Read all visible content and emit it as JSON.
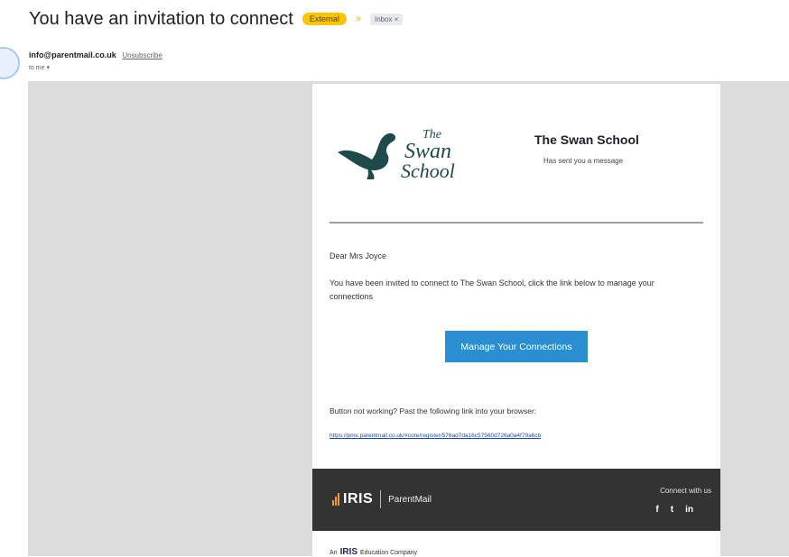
{
  "subject": "You have an invitation to connect",
  "labels": {
    "external": "External",
    "inbox": "Inbox ×"
  },
  "sender": {
    "email": "info@parentmail.co.uk",
    "unsubscribe": "Unsubscribe",
    "to": "to me"
  },
  "email": {
    "logo_text": [
      "The",
      "Swan",
      "School"
    ],
    "school_name": "The Swan School",
    "sent_message": "Has sent you a message",
    "greeting": "Dear Mrs Joyce",
    "body": "You have been invited to connect to The Swan School, click the link below to manage your connections",
    "cta_label": "Manage Your Connections",
    "fallback_text": "Button not working? Past the following link into your browser:",
    "link": "https://pmx.parentmail.co.uk/#core/register/576ad7da16c57560d726a0a4f79a6cb",
    "footer": {
      "brand": "IRIS",
      "product": "ParentMail",
      "connect": "Connect with us",
      "social": [
        "f",
        "t",
        "in"
      ]
    },
    "company": {
      "prefix": "An",
      "brand": "IRIS",
      "suffix": "Education Company"
    }
  },
  "colors": {
    "accent": "#2a8fd2",
    "external_badge": "#f9c500",
    "footer_bg": "#333333",
    "swan": "#1e4a4c"
  }
}
